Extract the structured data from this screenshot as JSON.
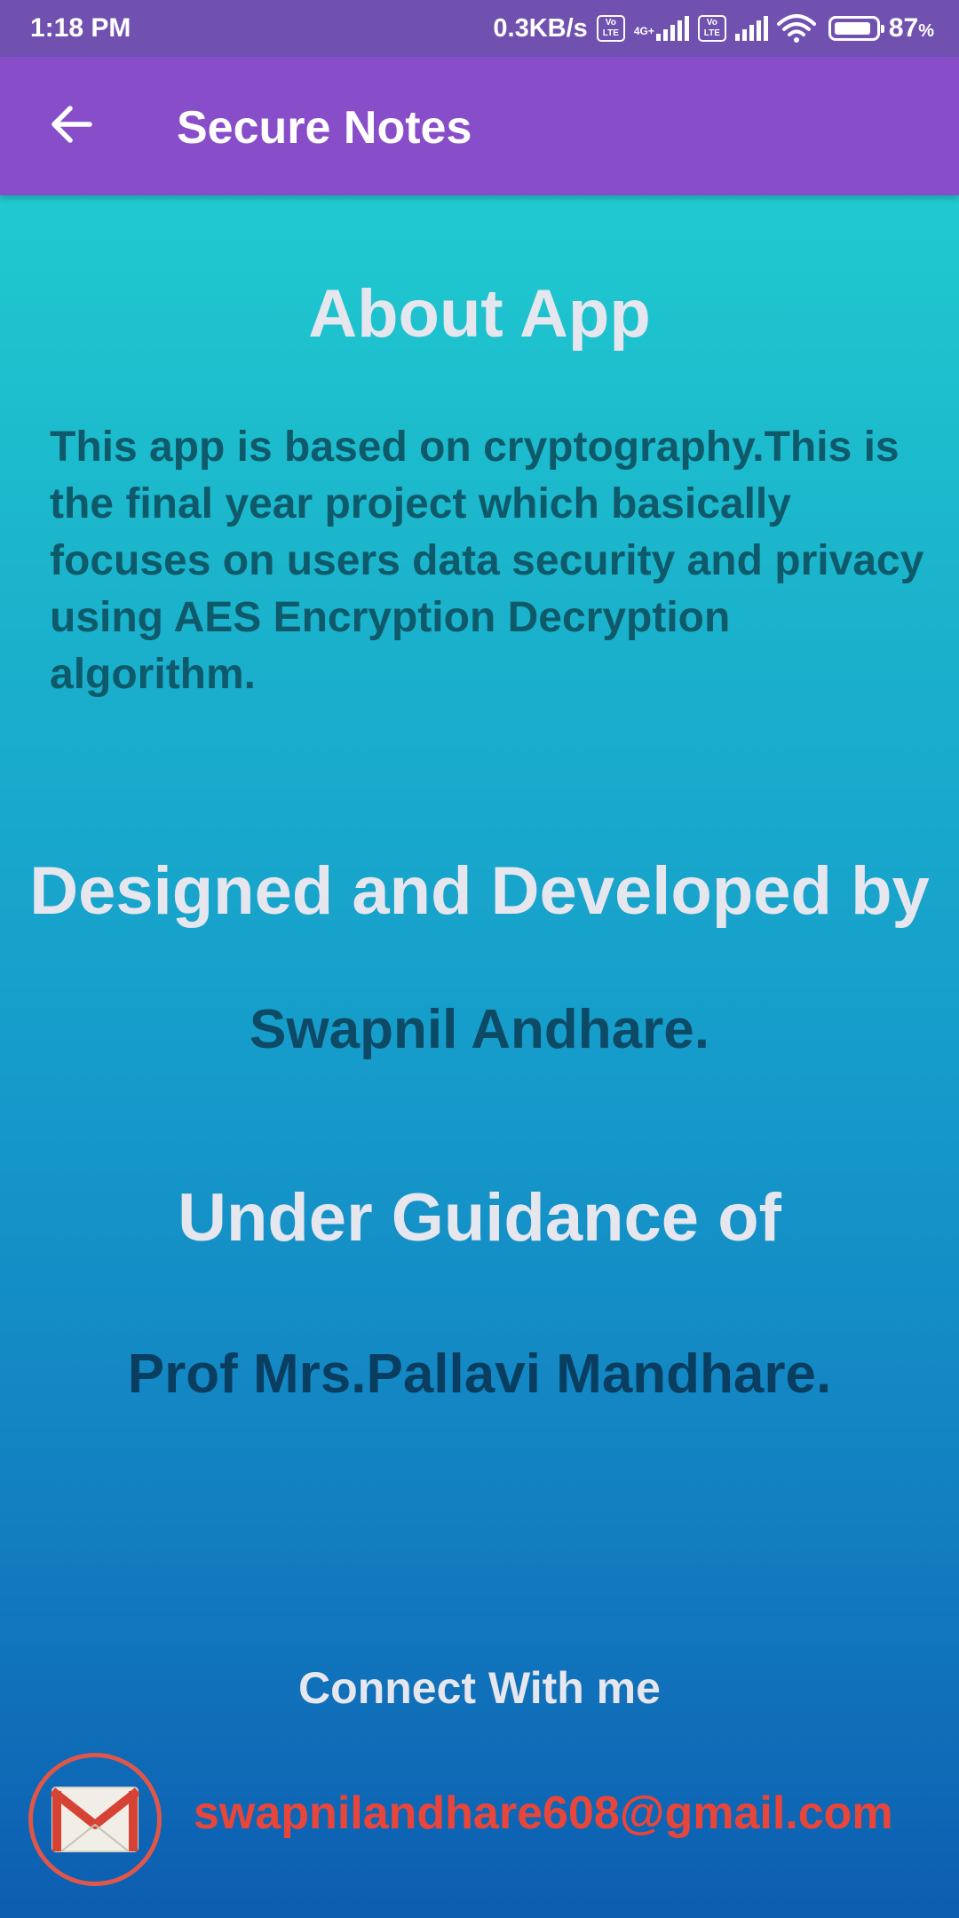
{
  "status_bar": {
    "time": "1:18 PM",
    "speed": "0.3KB/s",
    "volte_1": "Vo LTE",
    "network_label": "4G+",
    "volte_2": "Vo LTE",
    "battery_percent": "87",
    "battery_unit": "%"
  },
  "app_bar": {
    "title": "Secure Notes",
    "back_icon": "arrow-back-icon"
  },
  "about": {
    "title": "About App",
    "description": "This app is based on cryptography.This is the final year project which basically focuses on users data security and privacy using AES Encryption Decryption algorithm."
  },
  "credits": {
    "designed_title": "Designed and Developed by",
    "developer_name": "Swapnil Andhare.",
    "guidance_title": "Under Guidance of",
    "guide_name": "Prof Mrs.Pallavi Mandhare."
  },
  "connect": {
    "title": "Connect With me",
    "email": "swapnilandhare608@gmail.com",
    "icon": "gmail-icon"
  },
  "colors": {
    "status_bar": "#7051b0",
    "app_bar": "#884dc9",
    "gradient_top": "#22d4d1",
    "gradient_bottom": "#0d5db0",
    "heading_text": "#e6e6ee",
    "body_text": "#0e5a6a",
    "email_text": "#e8463a"
  }
}
